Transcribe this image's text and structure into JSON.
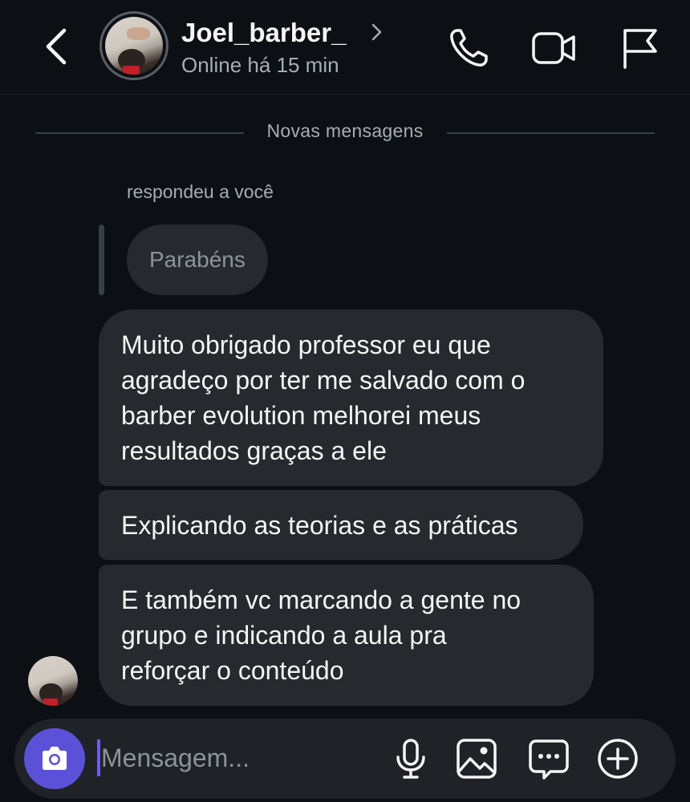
{
  "header": {
    "name": "Joel_barber_",
    "status": "Online há 15 min",
    "icons": [
      "chevron-left-icon",
      "phone-icon",
      "video-icon",
      "flag-icon"
    ]
  },
  "divider": {
    "label": "Novas mensagens"
  },
  "reply": {
    "note": "respondeu a você",
    "quoted": "Parabéns"
  },
  "messages": [
    {
      "text": "Muito obrigado professor eu que\nagradeço por ter me salvado com o\nbarber evolution melhorei meus\nresultados graças a ele"
    },
    {
      "text": "Explicando as teorias e as práticas"
    },
    {
      "text": "E também vc marcando a gente no\ngrupo e indicando a aula pra\nreforçar o conteúdo"
    }
  ],
  "composer": {
    "placeholder": "Mensagem...",
    "icons": [
      "camera-icon",
      "microphone-icon",
      "image-icon",
      "sticker-icon",
      "plus-icon"
    ]
  },
  "colors": {
    "background": "#0c1014",
    "bubble": "#26292e",
    "camera_button": "#5b51d8",
    "secondary_text": "#a8adb3"
  }
}
